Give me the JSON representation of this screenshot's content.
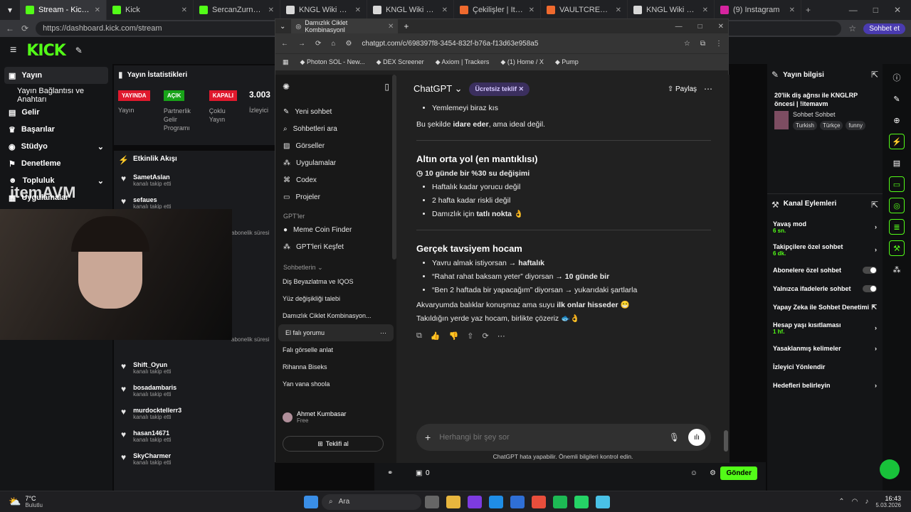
{
  "browser_tabs": [
    {
      "label": "Stream - Kick Dashboard",
      "color": "#53fc18"
    },
    {
      "label": "Kick",
      "color": "#53fc18"
    },
    {
      "label": "SercanZurna Stream - W",
      "color": "#53fc18"
    },
    {
      "label": "KNGL Wiki Portal",
      "color": "#d8d8d8"
    },
    {
      "label": "KNGL Wiki Portal",
      "color": "#d8d8d8"
    },
    {
      "label": "Çekilişler | ItemAVM",
      "color": "#f06a2e"
    },
    {
      "label": "VAULTCREATIVE TAKİPÇ",
      "color": "#f06a2e"
    },
    {
      "label": "KNGL Wiki Portal",
      "color": "#d8d8d8"
    },
    {
      "label": "(9) Instagram",
      "color": "#d6249f"
    }
  ],
  "address": {
    "url": "https://dashboard.kick.com/stream",
    "profile": "Sohbet et"
  },
  "kick": {
    "logo": "KICK",
    "nav": [
      "Yayın",
      "Yayın Bağlantısı ve Anahtarı",
      "Gelir",
      "Başarılar",
      "Stüdyo",
      "Denetleme",
      "Topluluk",
      "Uygulamalar"
    ],
    "stats_title": "Yayın İstatistikleri",
    "badges": [
      {
        "label": "YAYINDA",
        "sub": "Yayın",
        "color": "#e0192d"
      },
      {
        "label": "AÇIK",
        "sub": "Partnerlik Gelir Programı",
        "color": "#18a318"
      },
      {
        "label": "KAPALI",
        "sub": "Çoklu Yayın",
        "color": "#e0192d"
      }
    ],
    "viewers": "3.003",
    "viewers_label": "İzleyici",
    "activity_title": "Etkinlik Akışı",
    "feed_top": [
      {
        "name": "SametAslan",
        "sub": "kanalı takip etti"
      },
      {
        "name": "sefaues",
        "sub": "kanalı takip etti"
      }
    ],
    "feed_bottom": [
      {
        "name": "Shift_Oyun",
        "sub": "kanalı takip etti"
      },
      {
        "name": "bosadambaris",
        "sub": "kanalı takip etti"
      },
      {
        "name": "murdocktellerr3",
        "sub": "kanalı takip etti"
      },
      {
        "name": "hasan14671",
        "sub": "kanalı takip etti"
      },
      {
        "name": "SkyCharmer",
        "sub": "kanalı takip etti"
      }
    ],
    "sub_time_label": "abonelik süresi",
    "watermark": "itemAVM",
    "bottom_left": "0",
    "send_button": "Gönder"
  },
  "stream_info": {
    "title_label": "Yayın bilgisi",
    "title": "20'lik diş ağrısı ile KNGLRP öncesi | !itemavm",
    "category": "Sohbet Sohbet",
    "tags": [
      "Turkish",
      "Türkçe",
      "funny"
    ]
  },
  "channel_actions": {
    "title": "Kanal Eylemleri",
    "items": [
      {
        "label": "Yavaş mod",
        "sub": "6 sn.",
        "control": "chevron"
      },
      {
        "label": "Takipçilere özel sohbet",
        "sub": "6 dk.",
        "control": "chevron"
      },
      {
        "label": "Abonelere özel sohbet",
        "sub": "",
        "control": "toggle"
      },
      {
        "label": "Yalnızca ifadelerle sohbet",
        "sub": "",
        "control": "toggle"
      },
      {
        "label": "Yapay Zeka ile Sohbet Denetimi",
        "sub": "",
        "control": "link"
      },
      {
        "label": "Hesap yaşı kısıtlaması",
        "sub": "1 hf.",
        "control": "chevron"
      },
      {
        "label": "Yasaklanmış kelimeler",
        "sub": "",
        "control": "chevron"
      },
      {
        "label": "İzleyici Yönlendir",
        "sub": "",
        "control": "none"
      },
      {
        "label": "Hedefleri belirleyin",
        "sub": "",
        "control": "chevron"
      }
    ]
  },
  "chatgpt": {
    "tab_label": "Damızlık Ciklet Kombinasyonl",
    "url": "chatgpt.com/c/698397f8-3454-832f-b76a-f13d63e958a5",
    "bookmarks": [
      "Photon SOL - New...",
      "DEX Screener",
      "Axiom | Trackers",
      "(1) Home / X",
      "Pump"
    ],
    "model": "ChatGPT",
    "offer": "Ücretsiz teklif",
    "share": "Paylaş",
    "side_nav": [
      "Yeni sohbet",
      "Sohbetleri ara",
      "Görseller",
      "Uygulamalar",
      "Codex",
      "Projeler"
    ],
    "gpts_heading": "GPT'ler",
    "gpts": [
      "Meme Coin Finder",
      "GPT'leri Keşfet"
    ],
    "chats_heading": "Sohbetlerin",
    "chats": [
      "Diş Beyazlatma ve IQOS",
      "Yüz değişikliği talebi",
      "Damızlık Ciklet Kombinasyon...",
      "El falı yorumu",
      "Falı görselle anlat",
      "Rihanna Biseks",
      "Yan vana shoola"
    ],
    "user": {
      "name": "Ahmet Kumbasar",
      "plan": "Free"
    },
    "upgrade": "Teklifi al",
    "msg": {
      "b0": "Yemlemeyi biraz kıs",
      "p1a": "Bu şekilde ",
      "p1b": "idare eder",
      "p1c": ", ama ideal değil.",
      "h2": "Altın orta yol (en mantıklısı)",
      "h2sub": "10 günde bir %30 su değişimi",
      "b2": [
        "Haftalık kadar yorucu değil",
        "2 hafta kadar riskli değil"
      ],
      "b2c_a": "Damızlık için ",
      "b2c_b": "tatlı nokta",
      "h3": "Gerçek tavsiyem hocam",
      "b3a_a": "Yavru almak istiyorsan → ",
      "b3a_b": "haftalık",
      "b3b_a": "“Rahat rahat baksam yeter” diyorsan → ",
      "b3b_b": "10 günde bir",
      "b3c": "“Ben 2 haftada bir yapacağım” diyorsan → yukarıdaki şartlarla",
      "p2a": "Akvaryumda balıklar konuşmaz ama suyu ",
      "p2b": "ilk onlar hisseder",
      "p3": "Takıldığın yerde yaz hocam, birlikte çözeriz"
    },
    "input_placeholder": "Herhangi bir şey sor",
    "disclaimer": "ChatGPT hata yapabilir. Önemli bilgileri kontrol edin."
  },
  "taskbar": {
    "weather_temp": "7°C",
    "weather_desc": "Bulutlu",
    "search": "Ara",
    "time": "16:43",
    "date": "5.03.2026"
  }
}
